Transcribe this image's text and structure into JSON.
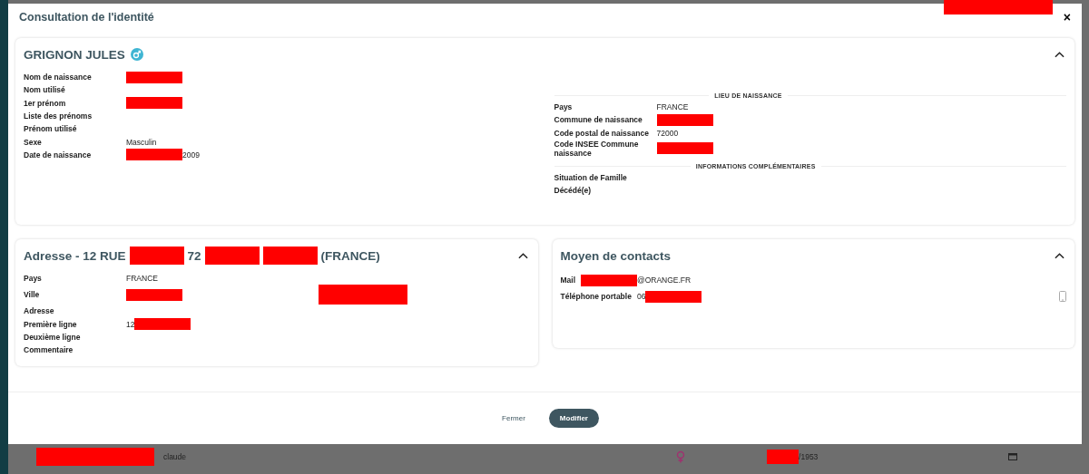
{
  "dialog": {
    "title": "Consultation de l'identité",
    "title_redacted": true,
    "close": "×"
  },
  "identity": {
    "name": "GRIGNON JULES",
    "kind": "male",
    "expanded": true,
    "fields": [
      {
        "label": "Nom de naissance",
        "parts": [
          {
            "kind": "redaction"
          }
        ]
      },
      {
        "label": "Nom utilisé"
      },
      {
        "label": "1er prénom",
        "parts": [
          {
            "kind": "redaction"
          }
        ]
      },
      {
        "label": "Liste des prénoms"
      },
      {
        "label": "Prénom utilisé"
      },
      {
        "label": "Sexe",
        "parts": [
          {
            "kind": "text",
            "text": "Masculin"
          }
        ]
      },
      {
        "label": "Date de naissance",
        "parts": [
          {
            "kind": "redaction"
          },
          {
            "kind": "text",
            "text": "2009"
          }
        ]
      }
    ],
    "sections": [
      {
        "title": "LIEU DE NAISSANCE",
        "fields": [
          {
            "label": "Pays",
            "parts": [
              {
                "kind": "text",
                "text": "FRANCE"
              }
            ]
          },
          {
            "label": "Commune de naissance",
            "parts": [
              {
                "kind": "redaction"
              }
            ]
          },
          {
            "label": "Code postal de naissance",
            "parts": [
              {
                "kind": "text",
                "text": "72000"
              }
            ]
          },
          {
            "label": "Code INSEE Commune naissance",
            "parts": [
              {
                "kind": "redaction"
              }
            ]
          }
        ]
      },
      {
        "title": "INFORMATIONS COMPLÉMENTAIRES",
        "fields": [
          {
            "label": "Situation de Famille"
          },
          {
            "label": "Décédé(e)"
          }
        ]
      }
    ]
  },
  "address": {
    "expanded": true,
    "title_parts": [
      {
        "kind": "text",
        "text": "Adresse  - 12 RUE"
      },
      {
        "kind": "redaction"
      },
      {
        "kind": "text",
        "text": "72"
      },
      {
        "kind": "redaction"
      },
      {
        "kind": "redaction"
      },
      {
        "kind": "text",
        "text": "(FRANCE)"
      }
    ],
    "fields": [
      {
        "label": "Pays",
        "parts": [
          {
            "kind": "text",
            "text": "FRANCE"
          }
        ]
      },
      {
        "label": "Ville",
        "parts": [
          {
            "kind": "redaction"
          },
          {
            "kind": "redaction"
          }
        ]
      },
      {
        "label": "Adresse"
      },
      {
        "label": "Première ligne",
        "parts": [
          {
            "kind": "text",
            "text": "12"
          },
          {
            "kind": "redaction"
          }
        ]
      },
      {
        "label": "Deuxième ligne"
      },
      {
        "label": "Commentaire"
      }
    ]
  },
  "contacts": {
    "title": "Moyen de contacts",
    "expanded": true,
    "items": [
      {
        "label": "Mail",
        "kind": "email",
        "parts": [
          {
            "kind": "redaction"
          },
          {
            "kind": "text",
            "text": "@ORANGE.FR"
          }
        ]
      },
      {
        "label": "Téléphone portable",
        "kind": "mobile",
        "parts": [
          {
            "kind": "text",
            "text": "06"
          },
          {
            "kind": "redaction"
          }
        ]
      }
    ]
  },
  "buttons": [
    {
      "label": "Fermer",
      "kind": "secondary"
    },
    {
      "label": "Modifier",
      "kind": "primary"
    }
  ],
  "background_row": {
    "parts": [
      {
        "kind": "redaction"
      },
      {
        "kind": "text",
        "text": "claude"
      }
    ],
    "date_parts": [
      {
        "kind": "redaction"
      },
      {
        "kind": "text",
        "text": "/1953"
      }
    ],
    "kind": "female"
  }
}
